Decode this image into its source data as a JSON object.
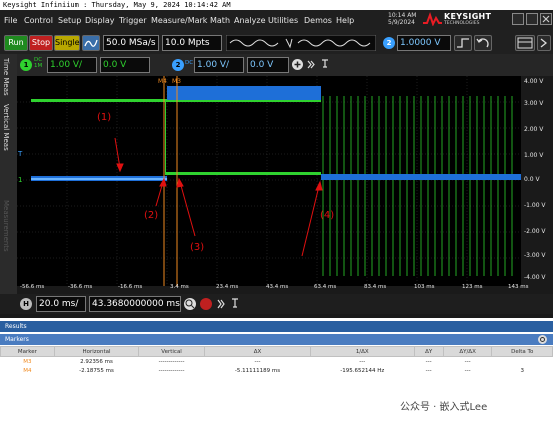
{
  "window_title": "Keysight Infiniium : Thursday, May 9, 2024 10:14:42 AM",
  "menu": [
    "File",
    "Control",
    "Setup",
    "Display",
    "Trigger",
    "Measure/Mark",
    "Math",
    "Analyze",
    "Utilities",
    "Demos",
    "Help"
  ],
  "clock": {
    "time": "10:14 AM",
    "date": "5/9/2024"
  },
  "brand": {
    "name": "KEYSIGHT",
    "sub": "TECHNOLOGIES"
  },
  "toolbar": {
    "run": "Run",
    "stop": "Stop",
    "single": "Single",
    "sample_rate": "50.0 MSa/s",
    "memory": "10.0 Mpts",
    "trigger_level": "1.0000 V"
  },
  "channels": {
    "ch1": {
      "num": "1",
      "coupling_top": "DC",
      "coupling_bot": "1M",
      "scale": "1.00 V/",
      "offset": "0.0 V"
    },
    "ch2": {
      "num": "2",
      "coupling": "DC",
      "scale": "1.00 V/",
      "offset": "0.0 V"
    }
  },
  "side_tabs": [
    "Time Meas",
    "Vertical Meas",
    "Measurements"
  ],
  "vertical_labels": [
    "4.00 V",
    "3.00 V",
    "2.00 V",
    "1.00 V",
    "0.0 V",
    "-1.00 V",
    "-2.00 V",
    "-3.00 V",
    "-4.00 V"
  ],
  "time_labels": [
    "-56.6 ms",
    "-36.6 ms",
    "-16.6 ms",
    "3.4 ms",
    "23.4 ms",
    "43.4 ms",
    "63.4 ms",
    "83.4 ms",
    "103 ms",
    "123 ms",
    "143 ms"
  ],
  "markers_on_screen": {
    "m4": "M4",
    "m3": "M3"
  },
  "annotations": [
    "(1)",
    "(2)",
    "(3)",
    "(4)"
  ],
  "horizontal": {
    "scale": "20.0 ms/",
    "position": "43.3680000000 ms"
  },
  "results": {
    "title": "Results",
    "tab": "Markers",
    "columns": [
      "Marker",
      "Horizontal",
      "Vertical",
      "ΔX",
      "1/ΔX",
      "ΔY",
      "ΔY/ΔX",
      "Delta To"
    ],
    "rows": [
      [
        "M3",
        "2.92356 ms",
        "-------------",
        "---",
        "---",
        "---",
        "---",
        ""
      ],
      [
        "M4",
        "-2.18755 ms",
        "-------------",
        "-5.11111189 ms",
        "-195.652144 Hz",
        "---",
        "---",
        "3"
      ]
    ]
  },
  "watermark": "公众号 · 嵌入式Lee",
  "colors": {
    "ch1": "#3aa0ff",
    "ch2": "#2fd22f",
    "marker": "#f08a20",
    "annotation": "#e01010",
    "run": "#1f8a1f",
    "stop": "#c02020",
    "single": "#b8a800"
  }
}
